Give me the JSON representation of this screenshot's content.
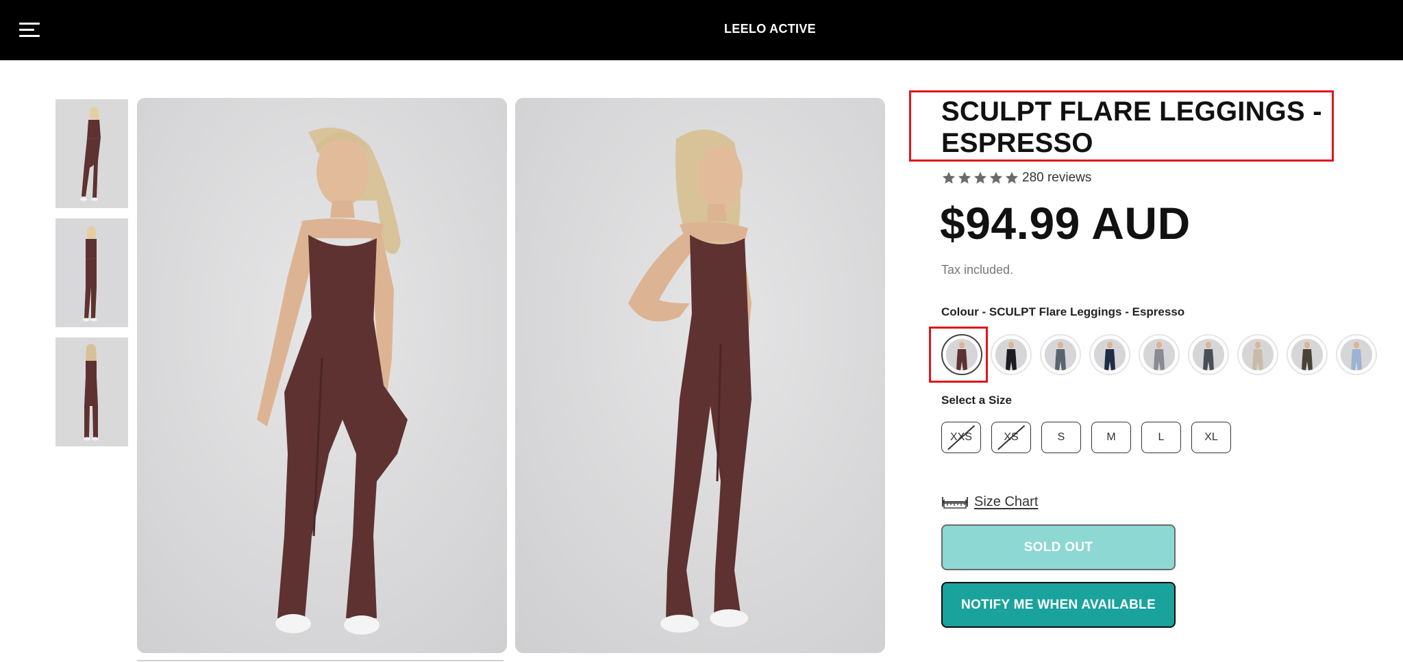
{
  "header": {
    "brand": "LEELO ACTIVE",
    "menu_icon": "hamburger-menu-icon",
    "background": "#000000"
  },
  "gallery": {
    "thumbnails": [
      {
        "alt": "Front pose"
      },
      {
        "alt": "Side pose"
      },
      {
        "alt": "Back pose"
      }
    ],
    "main_images": [
      {
        "alt": "Model front pose"
      },
      {
        "alt": "Model side pose"
      }
    ]
  },
  "product": {
    "title": "SCULPT FLARE LEGGINGS - ESPRESSO",
    "rating_stars": 5,
    "reviews": "280 reviews",
    "price": "$94.99 AUD",
    "tax_note": "Tax included.",
    "colour_label": "Colour - SCULPT Flare Leggings - Espresso",
    "colours": [
      {
        "name": "Espresso",
        "color": "#5e3230",
        "active": true
      },
      {
        "name": "Black",
        "color": "#1c1c22",
        "active": false
      },
      {
        "name": "Slate",
        "color": "#5a6470",
        "active": false
      },
      {
        "name": "Navy",
        "color": "#1f2d44",
        "active": false
      },
      {
        "name": "Grey",
        "color": "#8a8a92",
        "active": false
      },
      {
        "name": "Charcoal",
        "color": "#4a4e56",
        "active": false
      },
      {
        "name": "Stone",
        "color": "#c8bca8",
        "active": false
      },
      {
        "name": "Olive",
        "color": "#4b4236",
        "active": false
      },
      {
        "name": "Blue",
        "color": "#9db3cf",
        "active": false
      }
    ],
    "size_label": "Select a Size",
    "sizes": [
      {
        "label": "XXS",
        "available": false
      },
      {
        "label": "XS",
        "available": false
      },
      {
        "label": "S",
        "available": true
      },
      {
        "label": "M",
        "available": true
      },
      {
        "label": "L",
        "available": true
      },
      {
        "label": "XL",
        "available": true
      }
    ],
    "size_chart": "Size Chart",
    "sold_out": "SOLD OUT",
    "notify": "NOTIFY ME WHEN AVAILABLE"
  },
  "colors": {
    "accent": "#1aa39c",
    "soldout_bg": "#8ed8d4",
    "highlight": "#e0141b",
    "garment": "#5e3230"
  }
}
